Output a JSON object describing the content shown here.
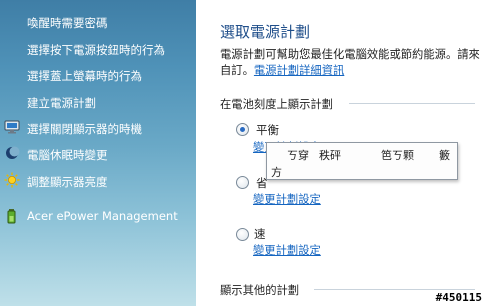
{
  "sidebar": {
    "items": [
      {
        "label": "喚醒時需要密碼",
        "icon": ""
      },
      {
        "label": "選擇按下電源按鈕時的行為",
        "icon": ""
      },
      {
        "label": "選擇蓋上螢幕時的行為",
        "icon": ""
      },
      {
        "label": "建立電源計劃",
        "icon": ""
      },
      {
        "label": "選擇關閉顯示器的時機",
        "icon": "monitor-icon"
      },
      {
        "label": "電腦休眠時變更",
        "icon": "moon-icon"
      },
      {
        "label": "調整顯示器亮度",
        "icon": "sun-icon"
      },
      {
        "label": "Acer ePower Management",
        "icon": "battery-icon"
      }
    ]
  },
  "main": {
    "title": "選取電源計劃",
    "description": "電源計劃可幫助您最佳化電腦效能或節約能源。請來自訂。",
    "description_link": "電源計劃詳細資訊",
    "section_battery": "在電池刻度上顯示計劃",
    "plans": [
      {
        "name": "平衡",
        "checked": true,
        "link": "變更計劃設定"
      },
      {
        "name": "省",
        "checked": false,
        "link": "變更計劃設定"
      },
      {
        "name": "速",
        "checked": false,
        "link": "變更計劃設定"
      }
    ],
    "section_other": "顯示其他的計劃"
  },
  "ime_popup": {
    "candidates": [
      "ㄎ穿",
      "秩砰",
      "笆ㄎ颗",
      "籔",
      "方"
    ]
  },
  "watermark": "#450115"
}
